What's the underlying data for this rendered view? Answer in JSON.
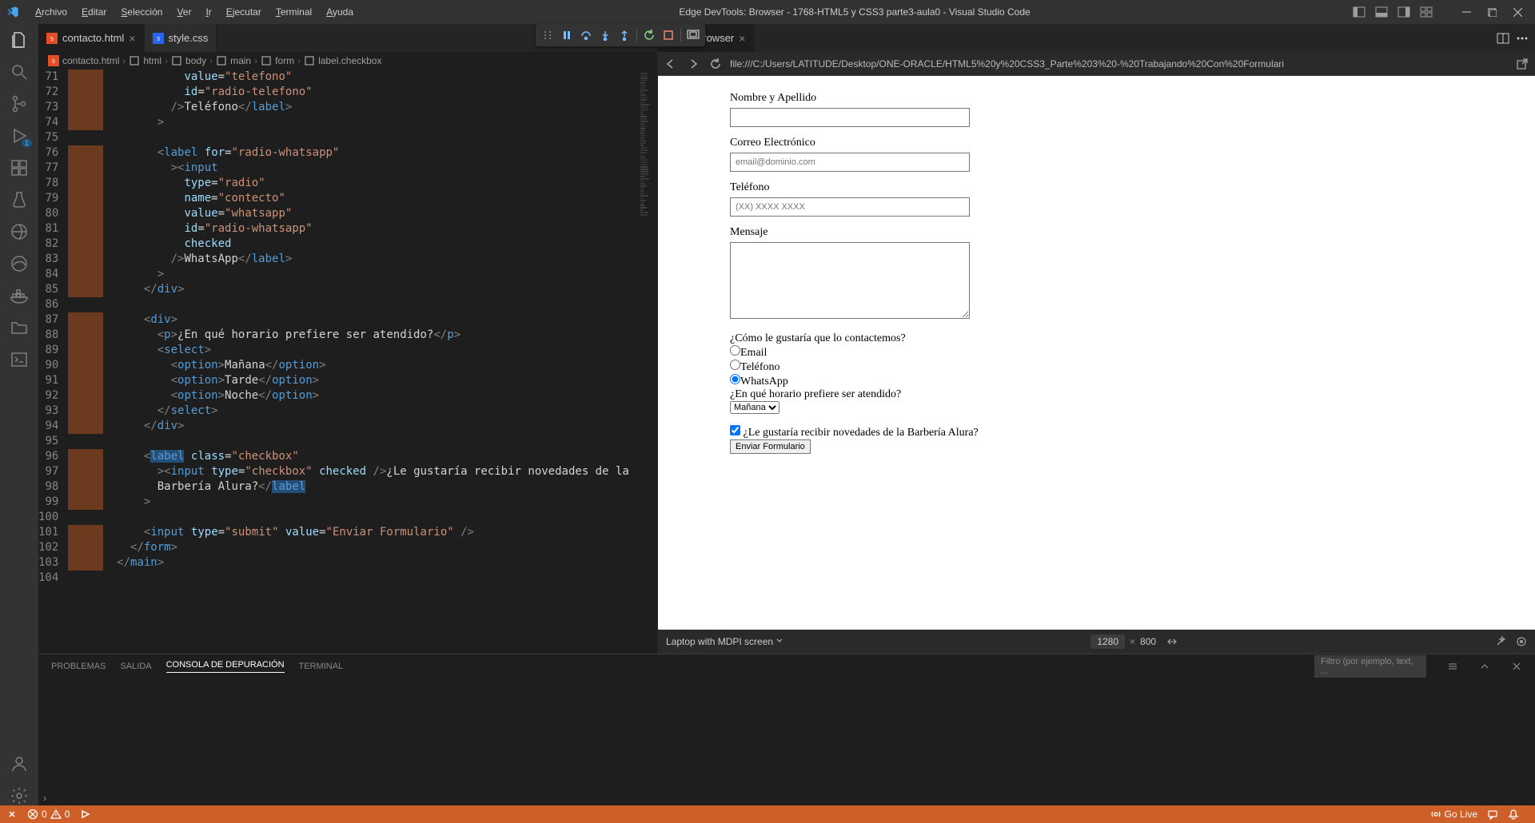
{
  "titlebar": {
    "menus": [
      "Archivo",
      "Editar",
      "Selección",
      "Ver",
      "Ir",
      "Ejecutar",
      "Terminal",
      "Ayuda"
    ],
    "title": "Edge DevTools: Browser - 1768-HTML5 y CSS3 parte3-aula0 - Visual Studio Code"
  },
  "tabs": {
    "left": [
      {
        "name": "contacto.html",
        "active": true,
        "icon": "html"
      },
      {
        "name": "style.css",
        "active": false,
        "icon": "css"
      }
    ],
    "right": [
      {
        "name": "Tools: Browser",
        "active": true,
        "close": true
      }
    ]
  },
  "breadcrumb": [
    "contacto.html",
    "html",
    "body",
    "main",
    "form",
    "label.checkbox"
  ],
  "code": [
    {
      "n": 71,
      "m": true,
      "html": "            <span class='tk-attr'>value</span>=<span class='tk-str'>\"telefono\"</span>"
    },
    {
      "n": 72,
      "m": true,
      "html": "            <span class='tk-attr'>id</span>=<span class='tk-str'>\"radio-telefono\"</span>"
    },
    {
      "n": 73,
      "m": true,
      "html": "          <span class='tk-brkt'>/&gt;</span><span class='tk-txt'>Teléfono</span><span class='tk-brkt'>&lt;/</span><span class='tk-tag'>label</span><span class='tk-brkt'>&gt;</span>"
    },
    {
      "n": 74,
      "m": true,
      "html": "        <span class='tk-brkt'>&gt;</span>"
    },
    {
      "n": 75,
      "m": false,
      "html": ""
    },
    {
      "n": 76,
      "m": true,
      "html": "        <span class='tk-brkt'>&lt;</span><span class='tk-tag'>label</span> <span class='tk-attr'>for</span>=<span class='tk-str'>\"radio-whatsapp\"</span>"
    },
    {
      "n": 77,
      "m": true,
      "html": "          <span class='tk-brkt'>&gt;&lt;</span><span class='tk-tag'>input</span>"
    },
    {
      "n": 78,
      "m": true,
      "html": "            <span class='tk-attr'>type</span>=<span class='tk-str'>\"radio\"</span>"
    },
    {
      "n": 79,
      "m": true,
      "html": "            <span class='tk-attr'>name</span>=<span class='tk-str'>\"contecto\"</span>"
    },
    {
      "n": 80,
      "m": true,
      "html": "            <span class='tk-attr'>value</span>=<span class='tk-str'>\"whatsapp\"</span>"
    },
    {
      "n": 81,
      "m": true,
      "html": "            <span class='tk-attr'>id</span>=<span class='tk-str'>\"radio-whatsapp\"</span>"
    },
    {
      "n": 82,
      "m": true,
      "html": "            <span class='tk-attr'>checked</span>"
    },
    {
      "n": 83,
      "m": true,
      "html": "          <span class='tk-brkt'>/&gt;</span><span class='tk-txt'>WhatsApp</span><span class='tk-brkt'>&lt;/</span><span class='tk-tag'>label</span><span class='tk-brkt'>&gt;</span>"
    },
    {
      "n": 84,
      "m": true,
      "html": "        <span class='tk-brkt'>&gt;</span>"
    },
    {
      "n": 85,
      "m": true,
      "html": "      <span class='tk-brkt'>&lt;/</span><span class='tk-tag'>div</span><span class='tk-brkt'>&gt;</span>"
    },
    {
      "n": 86,
      "m": false,
      "html": ""
    },
    {
      "n": 87,
      "m": true,
      "html": "      <span class='tk-brkt'>&lt;</span><span class='tk-tag'>div</span><span class='tk-brkt'>&gt;</span>"
    },
    {
      "n": 88,
      "m": true,
      "html": "        <span class='tk-brkt'>&lt;</span><span class='tk-tag'>p</span><span class='tk-brkt'>&gt;</span><span class='tk-txt'>¿En qué horario prefiere ser atendido?</span><span class='tk-brkt'>&lt;/</span><span class='tk-tag'>p</span><span class='tk-brkt'>&gt;</span>"
    },
    {
      "n": 89,
      "m": true,
      "html": "        <span class='tk-brkt'>&lt;</span><span class='tk-tag'>select</span><span class='tk-brkt'>&gt;</span>"
    },
    {
      "n": 90,
      "m": true,
      "html": "          <span class='tk-brkt'>&lt;</span><span class='tk-tag'>option</span><span class='tk-brkt'>&gt;</span><span class='tk-txt'>Mañana</span><span class='tk-brkt'>&lt;/</span><span class='tk-tag'>option</span><span class='tk-brkt'>&gt;</span>"
    },
    {
      "n": 91,
      "m": true,
      "html": "          <span class='tk-brkt'>&lt;</span><span class='tk-tag'>option</span><span class='tk-brkt'>&gt;</span><span class='tk-txt'>Tarde</span><span class='tk-brkt'>&lt;/</span><span class='tk-tag'>option</span><span class='tk-brkt'>&gt;</span>"
    },
    {
      "n": 92,
      "m": true,
      "html": "          <span class='tk-brkt'>&lt;</span><span class='tk-tag'>option</span><span class='tk-brkt'>&gt;</span><span class='tk-txt'>Noche</span><span class='tk-brkt'>&lt;/</span><span class='tk-tag'>option</span><span class='tk-brkt'>&gt;</span>"
    },
    {
      "n": 93,
      "m": true,
      "html": "        <span class='tk-brkt'>&lt;/</span><span class='tk-tag'>select</span><span class='tk-brkt'>&gt;</span>"
    },
    {
      "n": 94,
      "m": true,
      "html": "      <span class='tk-brkt'>&lt;/</span><span class='tk-tag'>div</span><span class='tk-brkt'>&gt;</span>"
    },
    {
      "n": 95,
      "m": false,
      "html": ""
    },
    {
      "n": 96,
      "m": true,
      "html": "      <span class='tk-brkt'>&lt;</span><span class='sel'><span class='tk-tag'>label</span></span> <span class='tk-attr'>class</span>=<span class='tk-str'>\"checkbox\"</span>"
    },
    {
      "n": 97,
      "m": true,
      "html": "        <span class='tk-brkt'>&gt;&lt;</span><span class='tk-tag'>input</span> <span class='tk-attr'>type</span>=<span class='tk-str'>\"checkbox\"</span> <span class='tk-attr'>checked</span> <span class='tk-brkt'>/&gt;</span><span class='tk-txt'>¿Le gustaría recibir novedades de la </span>"
    },
    {
      "n": 98,
      "m": true,
      "html": "        <span class='tk-txt'>Barbería Alura?</span><span class='tk-brkt'>&lt;/</span><span class='sel'><span class='tk-tag'>label</span></span>"
    },
    {
      "n": 99,
      "m": true,
      "html": "      <span class='tk-brkt'>&gt;</span>"
    },
    {
      "n": 100,
      "m": false,
      "html": ""
    },
    {
      "n": 101,
      "m": true,
      "html": "      <span class='tk-brkt'>&lt;</span><span class='tk-tag'>input</span> <span class='tk-attr'>type</span>=<span class='tk-str'>\"submit\"</span> <span class='tk-attr'>value</span>=<span class='tk-str'>\"Enviar Formulario\"</span> <span class='tk-brkt'>/&gt;</span>"
    },
    {
      "n": 102,
      "m": true,
      "html": "    <span class='tk-brkt'>&lt;/</span><span class='tk-tag'>form</span><span class='tk-brkt'>&gt;</span>"
    },
    {
      "n": 103,
      "m": true,
      "html": "  <span class='tk-brkt'>&lt;/</span><span class='tk-tag'>main</span><span class='tk-brkt'>&gt;</span>"
    },
    {
      "n": 104,
      "m": false,
      "html": ""
    }
  ],
  "addrbar": {
    "url": "file:///C:/Users/LATITUDE/Desktop/ONE-ORACLE/HTML5%20y%20CSS3_Parte%203%20-%20Trabajando%20Con%20Formulari"
  },
  "preview": {
    "name_label": "Nombre y Apellido",
    "email_label": "Correo Electrónico",
    "email_placeholder": "email@dominio.com",
    "phone_label": "Teléfono",
    "phone_placeholder": "(XX) XXXX XXXX",
    "message_label": "Mensaje",
    "contact_q": "¿Cómo le gustaría que lo contactemos?",
    "r1": "Email",
    "r2": "Teléfono",
    "r3": "WhatsApp",
    "schedule_q": "¿En qué horario prefiere ser atendido?",
    "schedule_opt": "Mañana",
    "newsletter": "¿Le gustaría recibir novedades de la Barbería Alura?",
    "submit": "Enviar Formulario"
  },
  "devicebar": {
    "device": "Laptop with MDPI screen",
    "w": "1280",
    "h": "800"
  },
  "panel": {
    "tabs": [
      "PROBLEMAS",
      "SALIDA",
      "CONSOLA DE DEPURACIÓN",
      "TERMINAL"
    ],
    "active": 2,
    "filter_placeholder": "Filtro (por ejemplo, text, ..."
  },
  "statusbar": {
    "errors": "0",
    "warnings": "0",
    "golive": "Go Live"
  },
  "debug_badge": "1"
}
